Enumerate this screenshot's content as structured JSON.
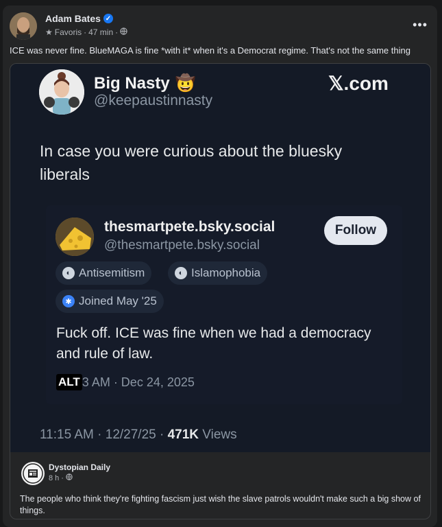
{
  "post": {
    "author": "Adam Bates",
    "audience": "Favoris",
    "time": "47 min",
    "text": "ICE was never fine. BlueMAGA is fine *with it* when it's a Democrat regime. That's not the same thing"
  },
  "tweet": {
    "name": "Big Nasty",
    "emoji": "🤠",
    "handle": "@keepaustinnasty",
    "site": "𝕏.com",
    "text": "In case you were curious about the bluesky liberals",
    "footer_time": "11:15 AM · 12/27/25 · ",
    "footer_views_count": "471K",
    "footer_views_label": " Views"
  },
  "quote": {
    "name": "thesmartpete.bsky.social",
    "handle": "@thesmartpete.bsky.social",
    "follow_label": "Follow",
    "badges": [
      "Antisemitism",
      "Islamophobia",
      "Joined May '25"
    ],
    "text": "Fuck off.  ICE was fine when we had a democracy and rule of law.",
    "alt_label": "ALT",
    "time": "3 AM · Dec 24, 2025"
  },
  "source": {
    "name": "Dystopian Daily",
    "time": "8 h",
    "text": "The people who think they're fighting fascism just wish the slave patrols wouldn't make such a big show of things."
  },
  "icons": {
    "more": "more-options-icon",
    "verified": "verified-badge-icon",
    "globe": "globe-icon",
    "star": "star-icon"
  },
  "colors": {
    "background": "#18191a",
    "card": "#242526",
    "tweet_bg": "#141a26",
    "verified": "#1877f2"
  }
}
